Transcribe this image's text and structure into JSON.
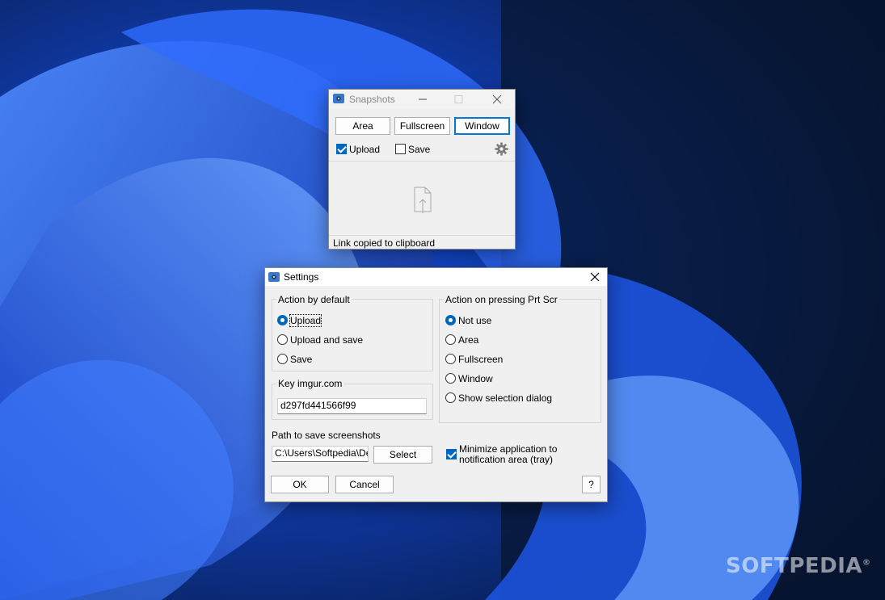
{
  "brand": {
    "watermark": "SOFTPEDIA",
    "mark": "®"
  },
  "snapshots": {
    "title": "Snapshots",
    "buttons": {
      "area": "Area",
      "fullscreen": "Fullscreen",
      "window": "Window"
    },
    "upload_label": "Upload",
    "save_label": "Save",
    "upload_checked": true,
    "save_checked": false,
    "status": "Link copied to clipboard"
  },
  "settings": {
    "title": "Settings",
    "action_default": {
      "title": "Action by default",
      "options": [
        "Upload",
        "Upload and save",
        "Save"
      ],
      "selected": 0
    },
    "key": {
      "title": "Key imgur.com",
      "value": "d297fd441566f99"
    },
    "prtscr": {
      "title": "Action on pressing Prt Scr",
      "options": [
        "Not use",
        "Area",
        "Fullscreen",
        "Window",
        "Show selection dialog"
      ],
      "selected": 0
    },
    "path": {
      "label": "Path to save screenshots",
      "value": "C:\\Users\\Softpedia\\Des",
      "select_label": "Select"
    },
    "minimize": {
      "line1": "Minimize application to",
      "line2": "notification area (tray)",
      "checked": true
    },
    "ok_label": "OK",
    "cancel_label": "Cancel",
    "help_label": "?"
  }
}
